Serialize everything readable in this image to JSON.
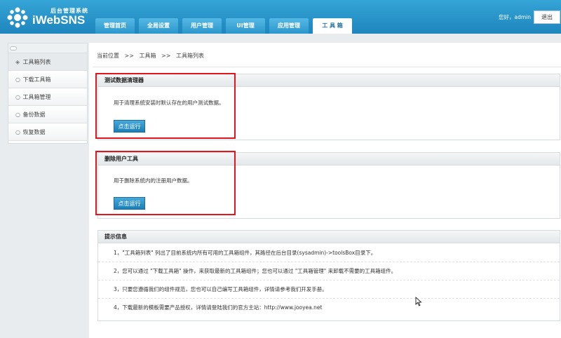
{
  "header": {
    "logo_subtitle": "后台管理系统",
    "logo_title": "iWebSNS",
    "greeting": "您好，admin",
    "logout_label": "退出",
    "nav": [
      {
        "label": "管理首页"
      },
      {
        "label": "全局设置"
      },
      {
        "label": "用户管理"
      },
      {
        "label": "UI管理"
      },
      {
        "label": "应用管理"
      },
      {
        "label": "工 具 箱",
        "active": true
      }
    ]
  },
  "sidebar": {
    "items": [
      {
        "label": "工具箱列表",
        "bullet": "◈",
        "active": true
      },
      {
        "label": "下载工具箱",
        "bullet": "○"
      },
      {
        "label": "工具箱管理",
        "bullet": "○"
      },
      {
        "label": "备份数据",
        "bullet": "○"
      },
      {
        "label": "恢复数据",
        "bullet": "○"
      }
    ]
  },
  "breadcrumb": {
    "prefix": "当前位置",
    "sep": ">>",
    "level1": "工具箱",
    "level2": "工具箱列表"
  },
  "tools": [
    {
      "title": "测试数据清理器",
      "desc": "用于清理系统安装时默认存在的用户测试数据。",
      "button": "点击运行"
    },
    {
      "title": "删除用户工具",
      "desc": "用于删除系统内的注册用户数据。",
      "button": "点击运行"
    }
  ],
  "tips": {
    "title": "提示信息",
    "items": [
      "1，\"工具箱列表\" 列出了目前系统内所有可用的工具箱组件，其路径在后台目录(sysadmin)->toolsBox目录下。",
      "2，您可以通过 \"下载工具箱\" 操作，来获取最新的工具箱组件；您也可以通过 \"工具箱管理\" 来卸载不需要的工具箱组件。",
      "3，只要您遵循我们的组件规范，您也可以自己编写工具箱组件，详情请参考我们开发手册。",
      "4，下载最新的模板需要产品授权，详情请登陆我们的官方主站：http://www.jooyea.net"
    ]
  },
  "colors": {
    "header": "#1e86bd",
    "highlight": "#e3161d",
    "button": "#1b7fb6"
  }
}
